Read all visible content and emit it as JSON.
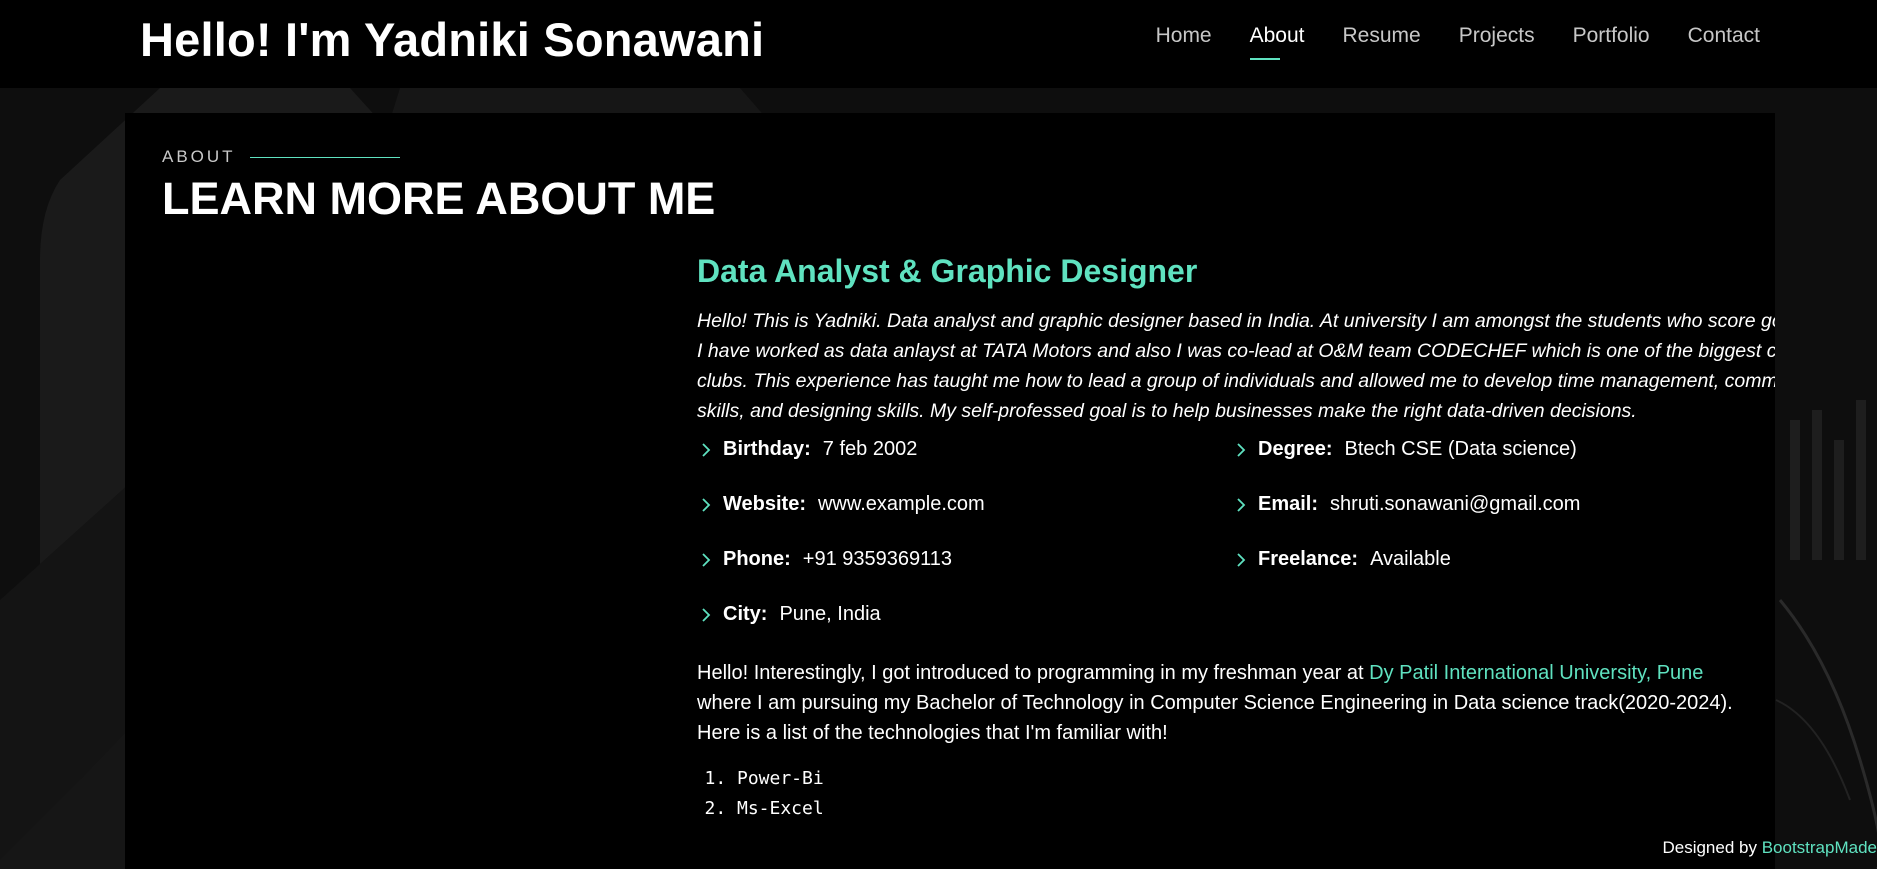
{
  "header": {
    "title": "Hello! I'm Yadniki Sonawani",
    "nav": [
      {
        "label": "Home"
      },
      {
        "label": "About"
      },
      {
        "label": "Resume"
      },
      {
        "label": "Projects"
      },
      {
        "label": "Portfolio"
      },
      {
        "label": "Contact"
      }
    ],
    "active_nav": "About"
  },
  "about": {
    "eyebrow": "ABOUT",
    "title": "LEARN MORE ABOUT ME",
    "role": "Data Analyst & Graphic Designer",
    "intro": "Hello! This is Yadniki. Data analyst and graphic designer based in India. At university I am amongst the students who score good grades, I have worked as data anlayst at TATA Motors and also I was co-lead at O&M team CODECHEF which is one of the biggest coding clubs. This experience has taught me how to lead a group of individuals and allowed me to develop time management, communication skills, and designing skills. My self-professed goal is to help businesses make the right data-driven decisions.",
    "details": {
      "birthday": {
        "label": "Birthday:",
        "value": "7 feb 2002"
      },
      "website": {
        "label": "Website:",
        "value": "www.example.com"
      },
      "phone": {
        "label": "Phone:",
        "value": "+91 9359369113"
      },
      "city": {
        "label": "City:",
        "value": "Pune, India"
      },
      "degree": {
        "label": "Degree:",
        "value": "Btech CSE (Data science)"
      },
      "email": {
        "label": "Email:",
        "value": "shruti.sonawani@gmail.com"
      },
      "freelance": {
        "label": "Freelance:",
        "value": "Available"
      }
    },
    "bio": {
      "before": "Hello! Interestingly, I got introduced to programming in my freshman year at ",
      "link": "Dy Patil International University, Pune",
      "after": " where I am pursuing my Bachelor of Technology in Computer Science Engineering in Data science track(2020-2024). Here is a list of the technologies that I'm familiar with!"
    },
    "technologies": [
      "Power-Bi",
      "Ms-Excel"
    ]
  },
  "footer": {
    "credit_prefix": "Designed by ",
    "credit_link": "BootstrapMade"
  },
  "colors": {
    "accent": "#5fe2c0",
    "background": "#000000"
  },
  "icons": {
    "detail_bullet": "chevron-right-icon"
  }
}
